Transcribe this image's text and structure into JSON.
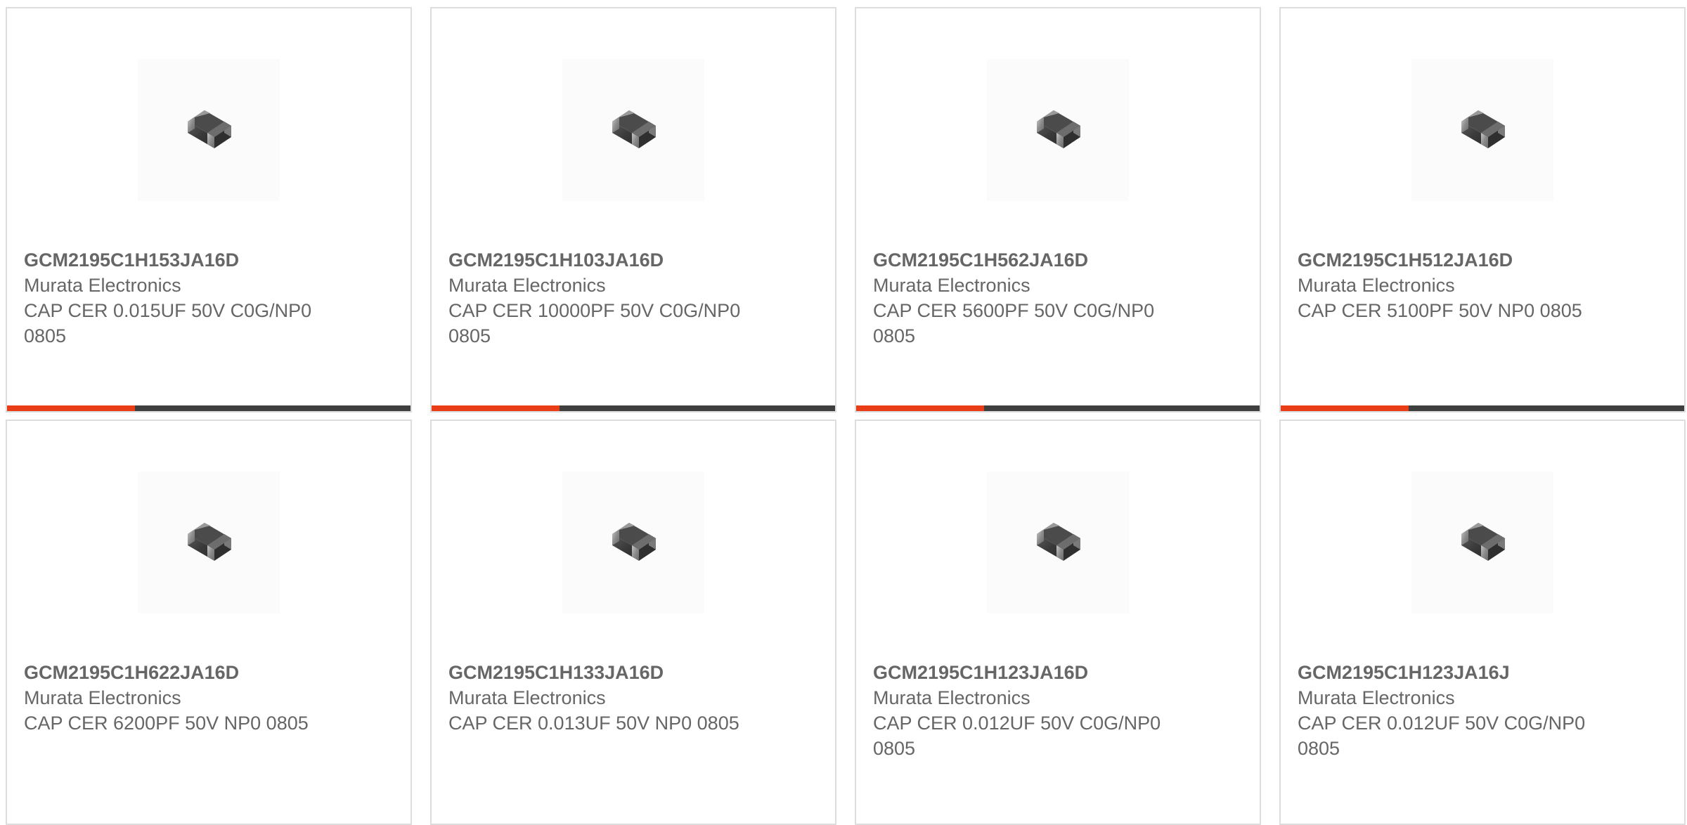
{
  "colors": {
    "accent": "#e93d18",
    "bar_dark": "#3f3f3f",
    "text": "#666666",
    "border": "#dddddd"
  },
  "products": [
    {
      "part_number": "GCM2195C1H153JA16D",
      "manufacturer": "Murata Electronics",
      "description": "CAP CER 0.015UF 50V C0G/NP0 0805",
      "image_icon": "ceramic-capacitor-chip-icon"
    },
    {
      "part_number": "GCM2195C1H103JA16D",
      "manufacturer": "Murata Electronics",
      "description": "CAP CER 10000PF 50V C0G/NP0 0805",
      "image_icon": "ceramic-capacitor-chip-icon"
    },
    {
      "part_number": "GCM2195C1H562JA16D",
      "manufacturer": "Murata Electronics",
      "description": "CAP CER 5600PF 50V C0G/NP0 0805",
      "image_icon": "ceramic-capacitor-chip-icon"
    },
    {
      "part_number": "GCM2195C1H512JA16D",
      "manufacturer": "Murata Electronics",
      "description": "CAP CER 5100PF 50V NP0 0805",
      "image_icon": "ceramic-capacitor-chip-icon"
    },
    {
      "part_number": "GCM2195C1H622JA16D",
      "manufacturer": "Murata Electronics",
      "description": "CAP CER 6200PF 50V NP0 0805",
      "image_icon": "ceramic-capacitor-chip-icon"
    },
    {
      "part_number": "GCM2195C1H133JA16D",
      "manufacturer": "Murata Electronics",
      "description": "CAP CER 0.013UF 50V NP0 0805",
      "image_icon": "ceramic-capacitor-chip-icon"
    },
    {
      "part_number": "GCM2195C1H123JA16D",
      "manufacturer": "Murata Electronics",
      "description": "CAP CER 0.012UF 50V C0G/NP0 0805",
      "image_icon": "ceramic-capacitor-chip-icon"
    },
    {
      "part_number": "GCM2195C1H123JA16J",
      "manufacturer": "Murata Electronics",
      "description": "CAP CER 0.012UF 50V C0G/NP0 0805",
      "image_icon": "ceramic-capacitor-chip-icon"
    }
  ]
}
